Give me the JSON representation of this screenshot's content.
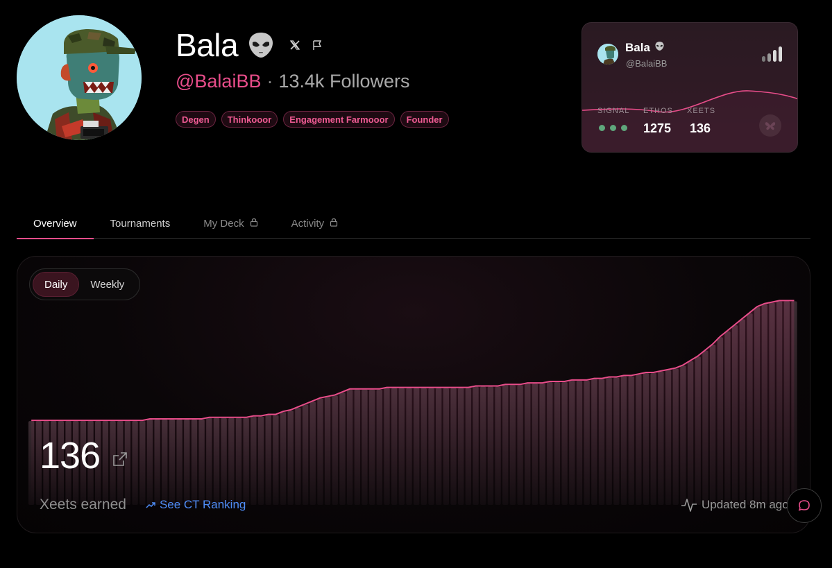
{
  "profile": {
    "name": "Bala",
    "name_emoji": "alien-emoji",
    "handle": "@BalaiBB",
    "separator": "·",
    "followers": "13.4k Followers",
    "tags": [
      "Degen",
      "Thinkooor",
      "Engagement Farmooor",
      "Founder"
    ]
  },
  "card": {
    "name": "Bala",
    "handle": "@BalaiBB",
    "stats": {
      "signal_label": "SIGNAL",
      "ethos_label": "ETHOS",
      "ethos_value": "1275",
      "xeets_label": "XEETS",
      "xeets_value": "136"
    },
    "signal_level": 3,
    "signal_color": "#5fa77c"
  },
  "tabs": [
    {
      "label": "Overview",
      "active": true,
      "locked": false
    },
    {
      "label": "Tournaments",
      "active": false,
      "locked": false
    },
    {
      "label": "My Deck",
      "active": false,
      "locked": true
    },
    {
      "label": "Activity",
      "active": false,
      "locked": true
    }
  ],
  "chart_controls": {
    "daily_label": "Daily",
    "weekly_label": "Weekly",
    "selected": "Daily"
  },
  "summary": {
    "value": "136",
    "label": "Xeets earned",
    "ranking_link": "See CT Ranking",
    "updated": "Updated 8m ago"
  },
  "colors": {
    "accent": "#e84d8a",
    "link": "#4f8df7",
    "background": "#000000"
  },
  "chart_data": {
    "type": "bar",
    "series": [
      {
        "values": [
          56,
          56,
          56,
          56,
          56,
          56,
          56,
          56,
          56,
          56,
          56,
          56,
          56,
          56,
          56,
          56,
          57,
          57,
          57,
          57,
          57,
          57,
          57,
          57,
          58,
          58,
          58,
          58,
          58,
          58,
          59,
          59,
          60,
          60,
          62,
          63,
          65,
          67,
          69,
          71,
          72,
          73,
          75,
          77,
          77,
          77,
          77,
          77,
          78,
          78,
          78,
          78,
          78,
          78,
          78,
          78,
          78,
          78,
          78,
          78,
          79,
          79,
          79,
          79,
          80,
          80,
          80,
          81,
          81,
          81,
          82,
          82,
          82,
          83,
          83,
          83,
          84,
          84,
          85,
          85,
          86,
          86,
          87,
          88,
          88,
          89,
          90,
          91,
          93,
          96,
          99,
          103,
          107,
          112,
          116,
          120,
          124,
          128,
          132,
          134,
          135,
          136,
          136,
          136
        ]
      }
    ],
    "ylim": [
      0,
      145
    ]
  }
}
